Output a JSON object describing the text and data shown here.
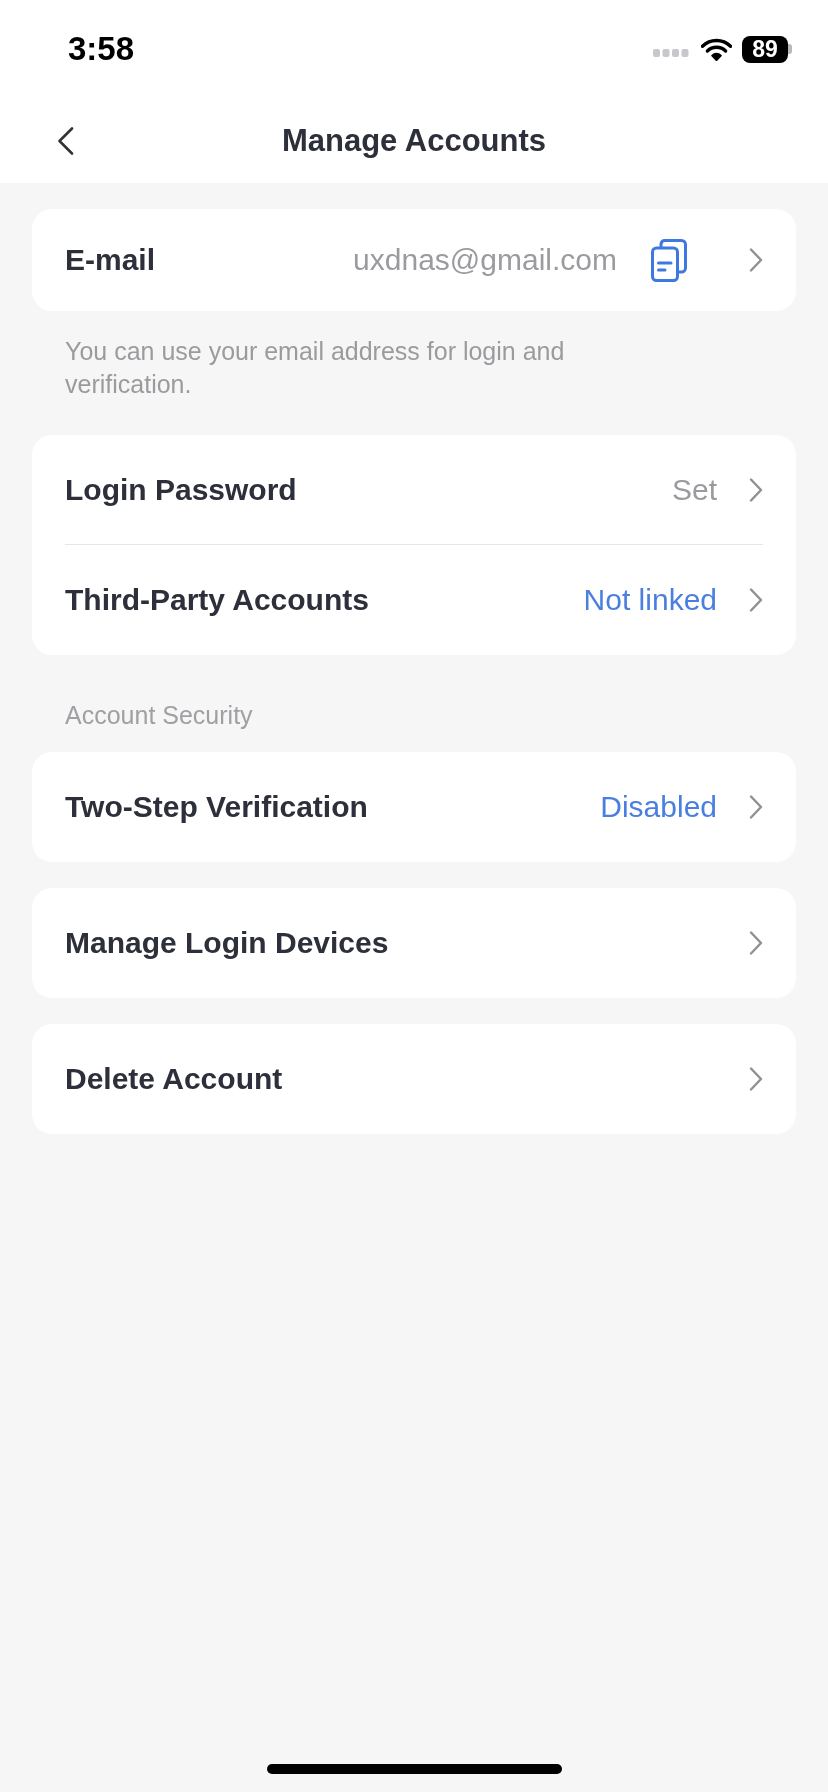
{
  "status_bar": {
    "time": "3:58",
    "battery": "89"
  },
  "nav_bar": {
    "title": "Manage Accounts"
  },
  "sections": [
    {
      "rows": [
        {
          "kind": "copyable",
          "label": "E-mail",
          "value": "uxdnas@gmail.com",
          "value_accent": false
        }
      ],
      "note": "You can use your email address for login and verification."
    },
    {
      "rows": [
        {
          "kind": "link",
          "label": "Login Password",
          "value": "Set",
          "value_accent": false
        },
        {
          "kind": "link",
          "label": "Third-Party Accounts",
          "value": "Not linked",
          "value_accent": true
        }
      ]
    },
    {
      "heading": "Account Security",
      "rows": [
        {
          "kind": "link",
          "label": "Two-Step Verification",
          "value": "Disabled",
          "value_accent": true
        }
      ]
    },
    {
      "rows": [
        {
          "kind": "link",
          "label": "Manage Login Devices"
        }
      ]
    },
    {
      "rows": [
        {
          "kind": "link",
          "label": "Delete Account"
        }
      ]
    }
  ]
}
